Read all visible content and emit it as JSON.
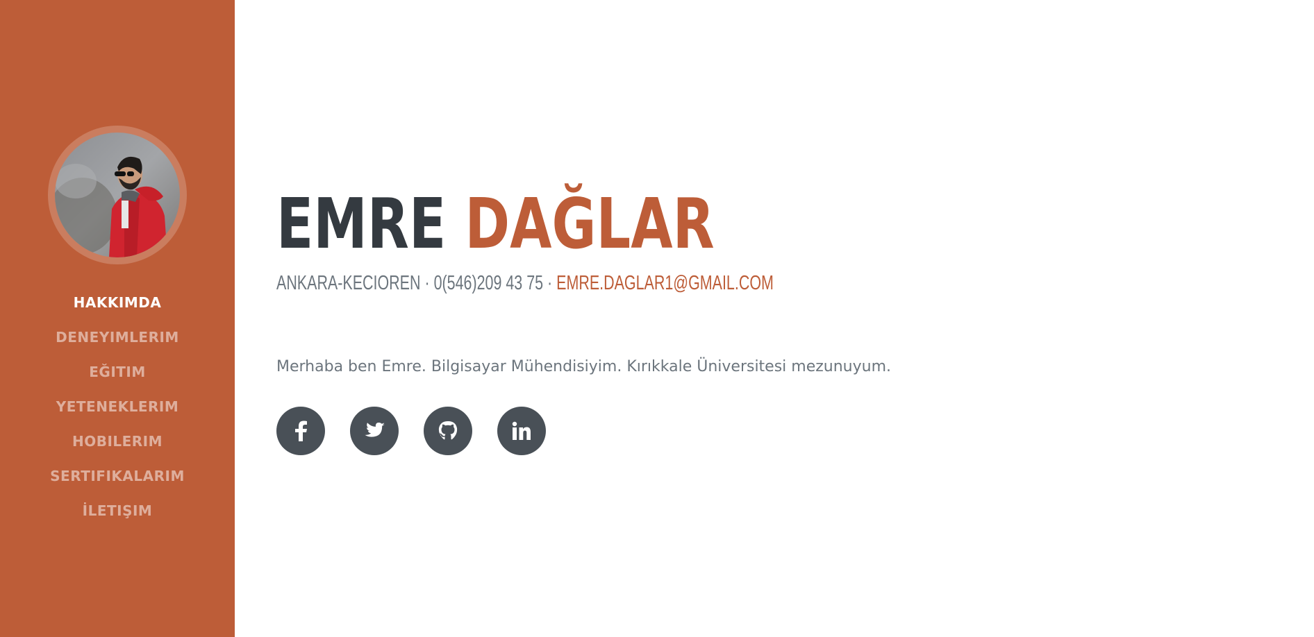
{
  "sidebar": {
    "avatar_alt": "Emre Dağlar",
    "nav": [
      {
        "label": "HAKKIMDA",
        "active": true
      },
      {
        "label": "DENEYIMLERIM",
        "active": false
      },
      {
        "label": "EĞITIM",
        "active": false
      },
      {
        "label": "YETENEKLERIM",
        "active": false
      },
      {
        "label": "HOBILERIM",
        "active": false
      },
      {
        "label": "SERTIFIKALARIM",
        "active": false
      },
      {
        "label": "İLETIŞIM",
        "active": false
      }
    ],
    "accent_color": "#bd5d38"
  },
  "about": {
    "first_name": "EMRE",
    "last_name": "DAĞLAR",
    "location": "ANKARA-KECIOREN",
    "separator": " · ",
    "phone": "0(546)209 43 75",
    "email": "EMRE.DAGLAR1@GMAIL.COM",
    "intro": "Merhaba ben Emre. Bilgisayar Mühendisiyim. Kırıkkale Üniversitesi mezunuyum."
  },
  "social": [
    {
      "icon": "facebook-icon"
    },
    {
      "icon": "twitter-icon"
    },
    {
      "icon": "github-icon"
    },
    {
      "icon": "linkedin-icon"
    }
  ],
  "colors": {
    "accent": "#bd5d38",
    "heading": "#343a40",
    "muted": "#6c757d",
    "social_bg": "#495057"
  }
}
